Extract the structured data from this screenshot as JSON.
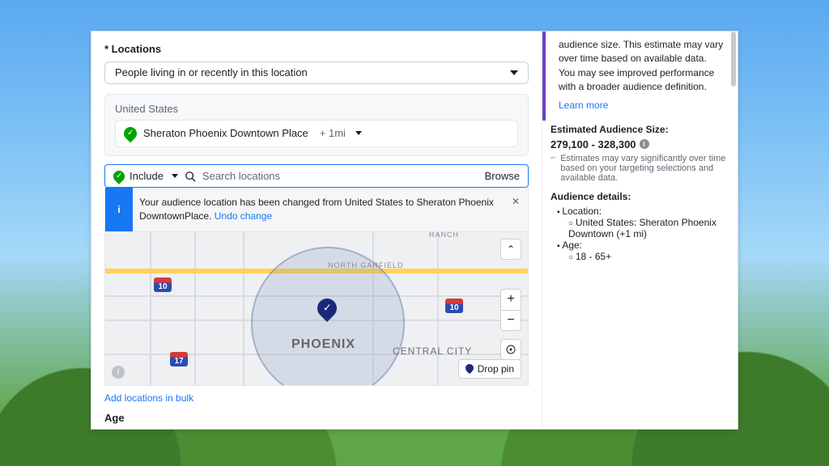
{
  "locations": {
    "title": "Locations",
    "dropdown_value": "People living in or recently in this location",
    "country": "United States",
    "place_name": "Sheraton Phoenix Downtown Place",
    "place_radius": "+ 1mi",
    "include_label": "Include",
    "search_placeholder": "Search locations",
    "browse_label": "Browse",
    "notice_text": "Your audience location has been changed from United States to Sheraton Phoenix DowntownPlace.",
    "undo_label": "Undo change",
    "bulk_link": "Add locations in bulk",
    "drop_pin_label": "Drop pin",
    "map": {
      "city_label": "PHOENIX",
      "central_label": "CENTRAL CITY",
      "garfield_label": "NORTH GARFIELD",
      "ranch_label": "RANCH",
      "shield10a": "10",
      "shield10b": "10",
      "shield17": "17",
      "zoom_in": "+",
      "zoom_out": "−",
      "expand": "⌃"
    }
  },
  "age": {
    "title": "Age"
  },
  "side": {
    "tip_text": "audience size. This estimate may vary over time based on available data. You may see improved performance with a broader audience definition.",
    "learn_more": "Learn more",
    "est_head": "Estimated Audience Size:",
    "est_value": "279,100 - 328,300",
    "est_note": "Estimates may vary significantly over time based on your targeting selections and available data.",
    "aud_head": "Audience details:",
    "loc_label": "Location:",
    "loc_value": "United States: Sheraton Phoenix Downtown (+1 mi)",
    "age_label": "Age:",
    "age_value": "18 - 65+"
  }
}
